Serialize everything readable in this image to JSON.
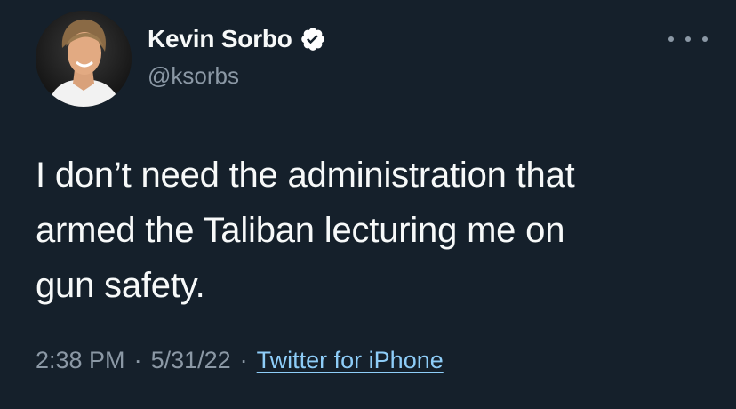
{
  "author": {
    "display_name": "Kevin Sorbo",
    "handle": "@ksorbs",
    "verified": true,
    "avatar_icon": "profile-photo",
    "verified_icon": "verified-badge-icon"
  },
  "tweet": {
    "lines": [
      "I don’t need the administration that",
      "armed the Taliban lecturing me on",
      "gun safety."
    ]
  },
  "meta": {
    "time": "2:38 PM",
    "separator": "·",
    "date": "5/31/22",
    "source": "Twitter for iPhone"
  },
  "menu": {
    "icon": "more-options-icon"
  },
  "colors": {
    "background": "#15202b",
    "text_primary": "#f7f9f9",
    "text_secondary": "#8b98a5",
    "link": "#8ecdf8",
    "verified_badge": "#ffffff"
  }
}
